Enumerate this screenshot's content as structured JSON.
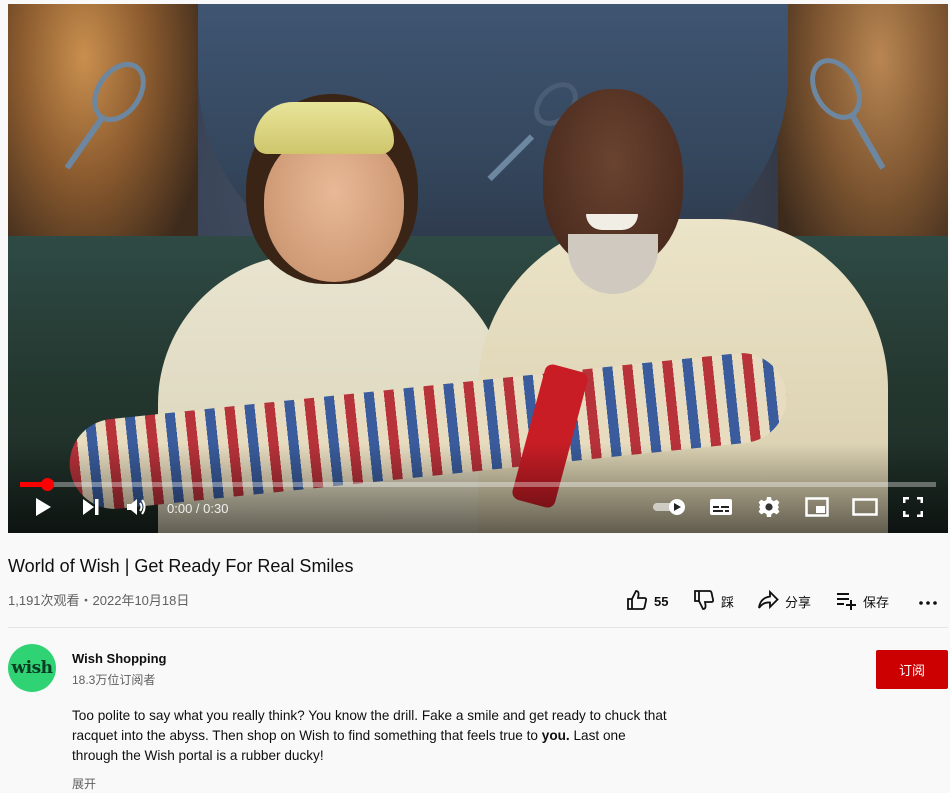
{
  "player": {
    "time_display": "0:00 / 0:30",
    "progress_fraction": 0.03,
    "controls": {
      "play": "play-icon",
      "next": "next-icon",
      "volume": "volume-icon",
      "autoplay": "autoplay-toggle-icon",
      "captions": "subtitles-icon",
      "settings": "gear-icon",
      "miniplayer": "miniplayer-icon",
      "theater": "theater-mode-icon",
      "fullscreen": "fullscreen-icon"
    }
  },
  "video": {
    "title": "World of Wish | Get Ready For Real Smiles",
    "views_date": "1,191次观看・2022年10月18日"
  },
  "actions": {
    "like_count": "55",
    "dislike_label": "踩",
    "share_label": "分享",
    "save_label": "保存",
    "more": "more-icon"
  },
  "channel": {
    "avatar_text": "wish",
    "name": "Wish Shopping",
    "subscribers": "18.3万位订阅者",
    "subscribe_label": "订阅"
  },
  "description": {
    "line1": "Too polite to say what you really think? You know the drill. Fake a smile and get ready to chuck that",
    "line2_a": "racquet into the abyss. Then shop on Wish to find something that feels true to ",
    "line2_bold": "you.",
    "line2_b": " Last one",
    "line3": "through the Wish portal is a rubber ducky!",
    "expand_label": "展开"
  },
  "colors": {
    "accent_red": "#ff0000",
    "subscribe_red": "#cc0000",
    "avatar_green": "#2fd373"
  }
}
